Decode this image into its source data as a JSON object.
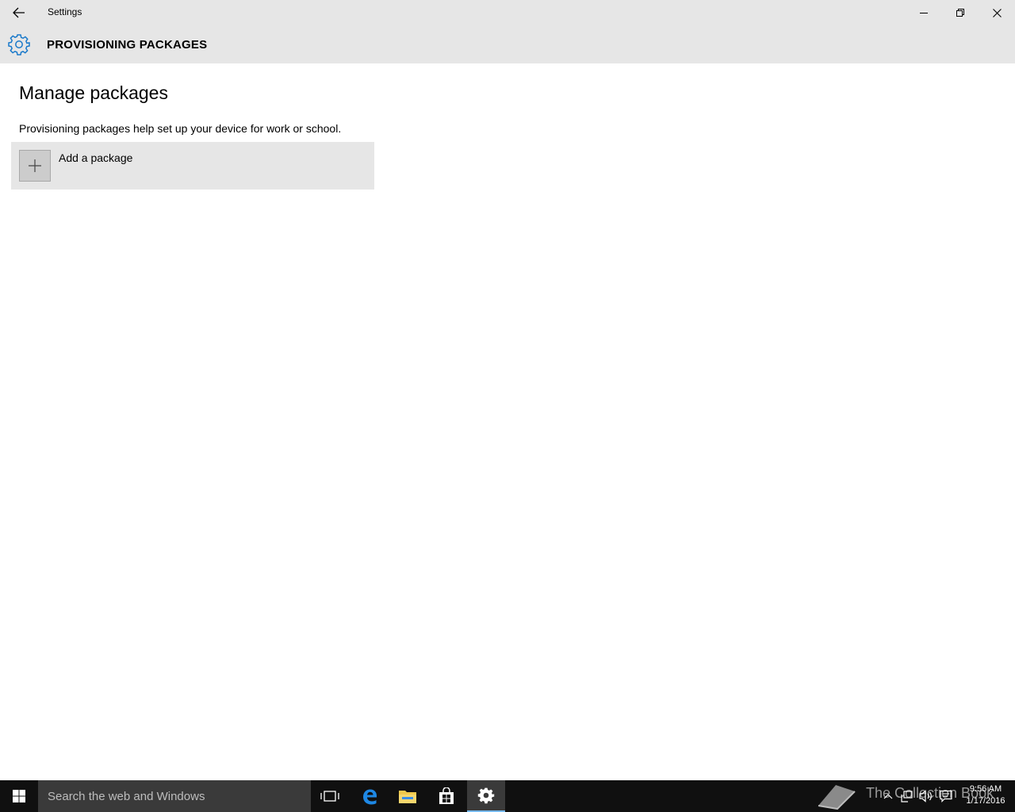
{
  "window": {
    "title": "Settings"
  },
  "header": {
    "title": "PROVISIONING PACKAGES",
    "icon": "gear-icon",
    "accent_color": "#1979ca"
  },
  "main": {
    "section_title": "Manage packages",
    "description": "Provisioning packages help set up your device for work or school.",
    "add_package_label": "Add a package"
  },
  "taskbar": {
    "search_placeholder": "Search the web and Windows",
    "pinned": [
      "task-view-icon",
      "edge-icon",
      "file-explorer-icon",
      "store-icon",
      "settings-icon"
    ],
    "watermark": "The Collection Book",
    "time": "9:56 AM",
    "date": "1/17/2016"
  }
}
